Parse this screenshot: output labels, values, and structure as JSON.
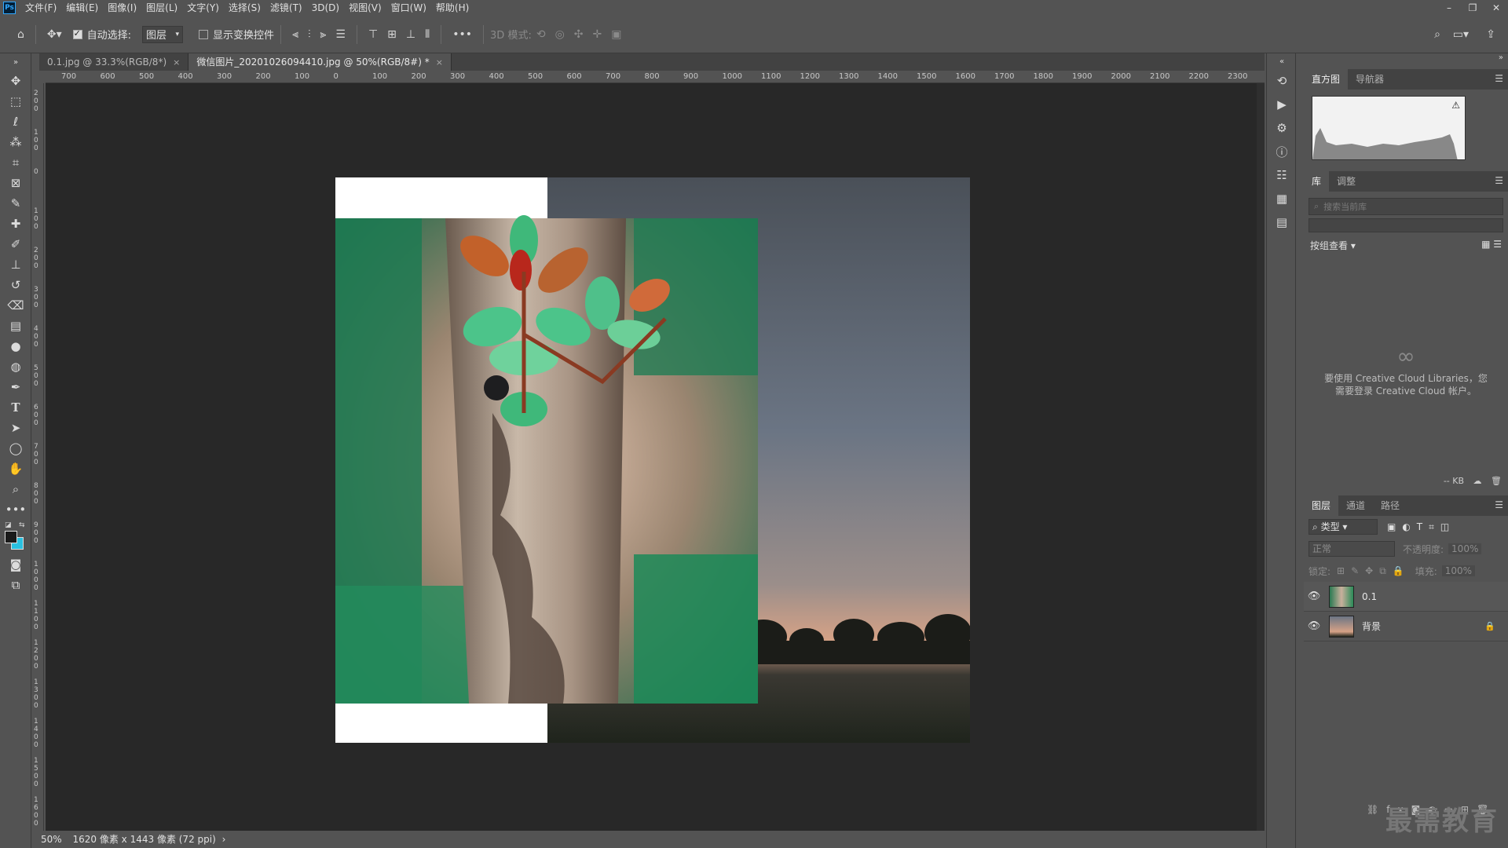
{
  "app": {
    "logo": "Ps"
  },
  "menubar": {
    "items": [
      "文件(F)",
      "编辑(E)",
      "图像(I)",
      "图层(L)",
      "文字(Y)",
      "选择(S)",
      "滤镜(T)",
      "3D(D)",
      "视图(V)",
      "窗口(W)",
      "帮助(H)"
    ],
    "window_controls": {
      "minimize": "–",
      "restore": "❐",
      "close": "✕"
    }
  },
  "options": {
    "auto_select_label": "自动选择:",
    "auto_select_checked": true,
    "layer_select_value": "图层",
    "show_transform_label": "显示变换控件",
    "show_transform_checked": false,
    "more_label": "•••",
    "mode_3d_label": "3D 模式:"
  },
  "tabs": [
    {
      "label": "0.1.jpg @ 33.3%(RGB/8*)",
      "active": false
    },
    {
      "label": "微信图片_20201026094410.jpg @ 50%(RGB/8#) *",
      "active": true
    }
  ],
  "ruler": {
    "h_labels": [
      "700",
      "600",
      "500",
      "400",
      "300",
      "200",
      "100",
      "0",
      "100",
      "200",
      "300",
      "400",
      "500",
      "600",
      "700",
      "800",
      "900",
      "1000",
      "1100",
      "1200",
      "1300",
      "1400",
      "1500",
      "1600",
      "1700",
      "1800",
      "1900",
      "2000",
      "2100",
      "2200",
      "2300"
    ],
    "v_labels": [
      "2\n0\n0",
      "1\n0\n0",
      "0",
      "1\n0\n0",
      "2\n0\n0",
      "3\n0\n0",
      "4\n0\n0",
      "5\n0\n0",
      "6\n0\n0",
      "7\n0\n0",
      "8\n0\n0",
      "9\n0\n0",
      "1\n0\n0\n0",
      "1\n1\n0\n0",
      "1\n2\n0\n0",
      "1\n3\n0\n0",
      "1\n4\n0\n0",
      "1\n5\n0\n0",
      "1\n6\n0\n0"
    ]
  },
  "status": {
    "zoom": "50%",
    "doc_info": "1620 像素 x 1443 像素 (72 ppi)",
    "more": "›"
  },
  "panels": {
    "histogram_tabs": [
      "直方图",
      "导航器"
    ],
    "library_tabs": [
      "库",
      "调整"
    ],
    "library_search_placeholder": "搜索当前库",
    "library_view_label": "按组查看",
    "cc_message_line1": "要使用 Creative Cloud Libraries，您",
    "cc_message_line2": "需要登录 Creative Cloud 帐户。",
    "library_size": "-- KB",
    "layers_tabs": [
      "图层",
      "通道",
      "路径"
    ],
    "layer_filter": "类型",
    "blend_mode": "正常",
    "opacity_label": "不透明度:",
    "opacity_value": "100%",
    "lock_label": "锁定:",
    "fill_label": "填充:",
    "fill_value": "100%",
    "layers": [
      {
        "name": "0.1",
        "visible": true,
        "locked": false
      },
      {
        "name": "背景",
        "visible": true,
        "locked": true
      }
    ]
  },
  "watermark": "最需教育",
  "colors": {
    "ui_bg": "#535353",
    "canvas_bg": "#282828",
    "accent_fg_color": "#1a1a1a",
    "accent_bg_color": "#2ac0e0"
  }
}
